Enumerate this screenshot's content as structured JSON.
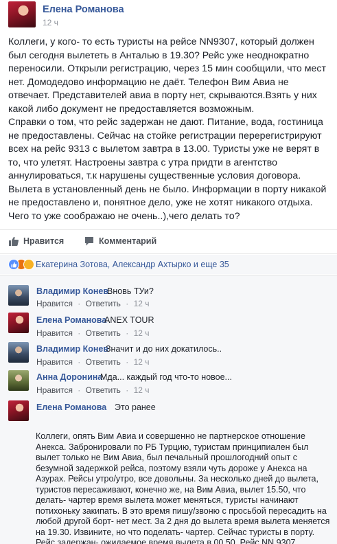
{
  "post": {
    "author": "Елена Романова",
    "time": "12 ч",
    "paragraphs": [
      "Коллеги, у кого- то есть туристы на рейсе NN9307, который должен был сегодня вылететь в Анталью в 19.30? Рейс уже неоднократно переносили. Открыли регистрацию, через 15 мин сообщили, что мест нет. Домодедово информацию не даёт. Телефон Вим Авиа не отвечает. Представителей авиа в порту нет, скрываются.Взять у них какой либо документ не предоставляется возможным.",
      "Справки о том, что рейс задержан не дают. Питание, вода, гостиница не предоставлены. Сейчас на стойке регистрации перерегистрируют всех на рейс 9313 с вылетом завтра в 13.00. Туристы уже не верят в то, что улетят. Настроены завтра с утра придти в агентство аннулироваться, т.к нарушены существенные условия договора.",
      "Вылета в установленный день не было. Информации в порту никакой не предоставлено и, понятное дело, уже не хотят никакого отдыха. Чего то уже соображаю не очень..),чего делать то?"
    ]
  },
  "actions": {
    "like_label": "Нравится",
    "comment_label": "Комментарий"
  },
  "reactions": {
    "text": "Екатерина Зотова, Александр Ахтырко и еще 35",
    "colors": {
      "like": "#5890ff",
      "angry": "#e9710f",
      "sad": "#f7b125"
    }
  },
  "comment_labels": {
    "like": "Нравится",
    "reply": "Ответить",
    "separator": "·",
    "time": "12 ч"
  },
  "comments": [
    {
      "author": "Владимир Конев",
      "text": "Вновь ТУи?"
    },
    {
      "author": "Елена Романова",
      "text": "ANEX TOUR"
    },
    {
      "author": "Владимир Конев",
      "text": "Значит и до них докатилось.."
    },
    {
      "author": "Анна Доронина",
      "text": "Мда... каждый год что-то новое..."
    },
    {
      "author": "Елена Романова",
      "text": "Это ранее",
      "quoted": [
        "Коллеги, опять Вим Авиа и совершенно не партнерское отношение Анекса. Забронировали по РБ Турцию, туристам принципиален был вылет только не Вим Авиа, был печальный прошлогодний опыт с безумной задержкой рейса, поэтому взяли чуть дороже у Анекса на Азурах. Рейсы утро/утро, все довольны. За несколько дней до вылета, туристов пересаживают, конечно же, на Вим Авиа, вылет 15.50, что делать- чартер время вылета может меняться, туристы начинают потихоньку закипать. В это время пишу/звоню с просьбой пересадить на любой другой борт- нет мест. За 2 дня до вылета время вылета меняется на 19.30. Извините, но что поделать- чартер. Сейчас туристы в порту. Рейс задержан- ожидаемое время вылета в 00.50. Рейс NN 9307. Туристы с истериками,"
      ]
    }
  ]
}
